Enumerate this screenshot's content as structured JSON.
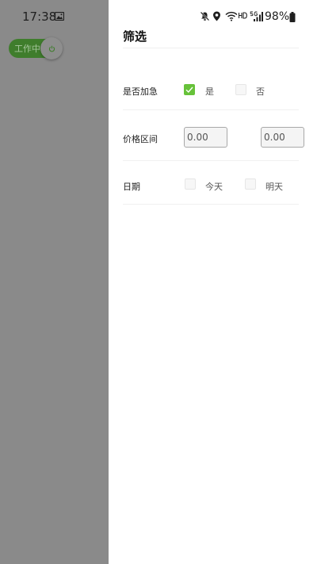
{
  "status_bar": {
    "time": "17:38",
    "battery": "98%"
  },
  "work_toggle": {
    "label": "工作中",
    "on": true
  },
  "filter": {
    "title": "筛选",
    "urgent": {
      "label": "是否加急",
      "options": [
        {
          "label": "是",
          "checked": true
        },
        {
          "label": "否",
          "checked": false
        }
      ]
    },
    "price": {
      "label": "价格区间",
      "min": "0.00",
      "max": "0.00"
    },
    "date": {
      "label": "日期",
      "options": [
        {
          "label": "今天",
          "checked": false
        },
        {
          "label": "明天",
          "checked": false
        }
      ]
    }
  },
  "colors": {
    "accent": "#67c23a",
    "toggle_bg": "#3f7d2c",
    "overlay": "#8a8a8a"
  }
}
